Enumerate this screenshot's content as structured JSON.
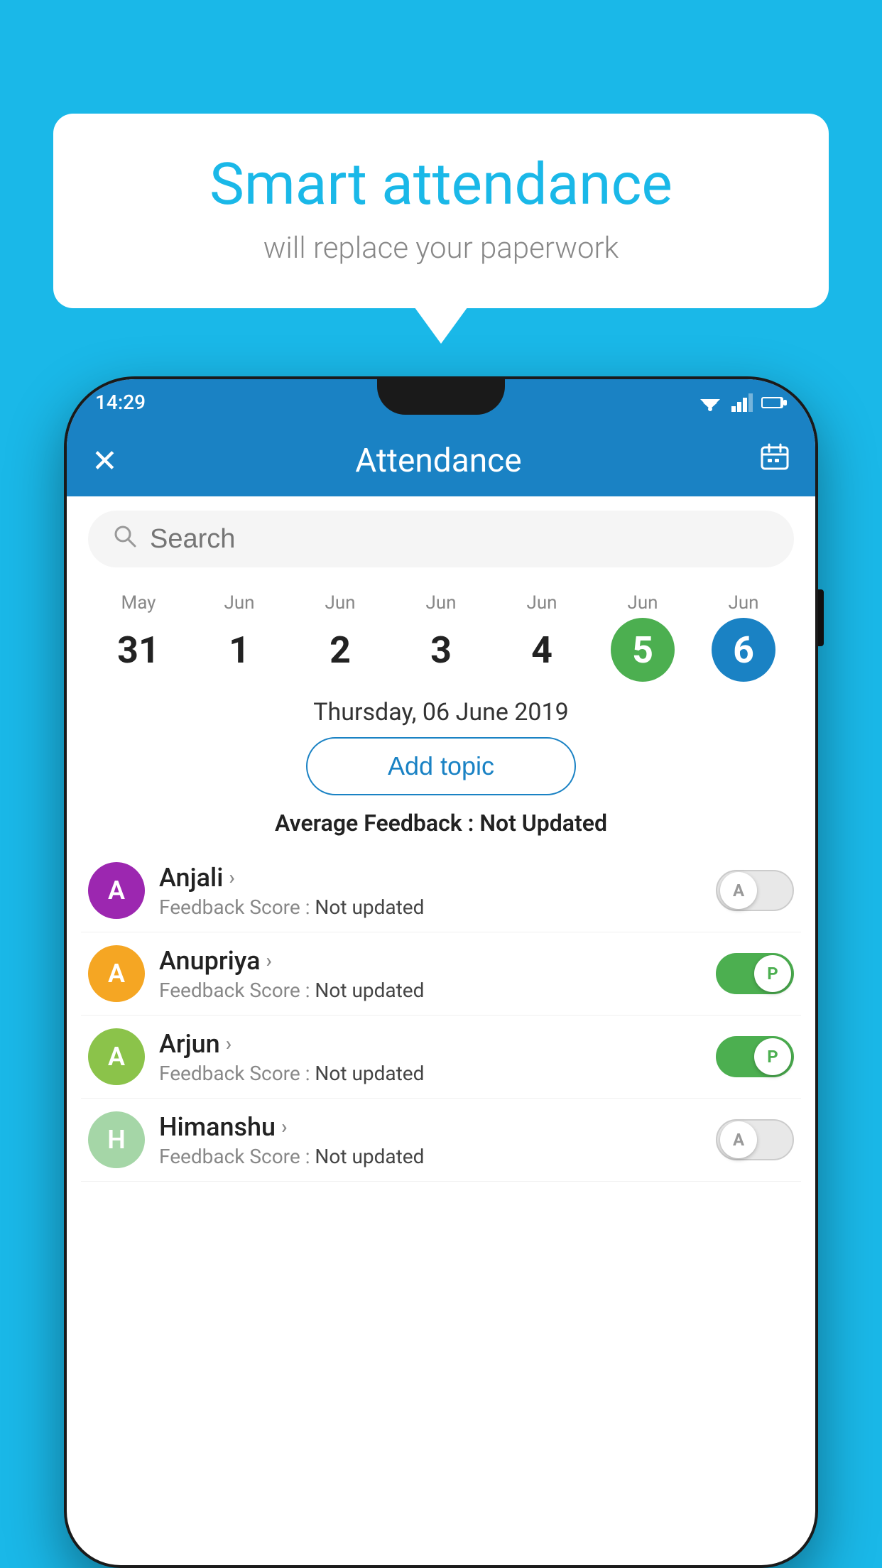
{
  "background_color": "#1ab8e8",
  "bubble": {
    "title": "Smart attendance",
    "subtitle": "will replace your paperwork"
  },
  "status_bar": {
    "time": "14:29"
  },
  "app_bar": {
    "title": "Attendance",
    "close_icon": "✕",
    "calendar_icon": "📅"
  },
  "search": {
    "placeholder": "Search"
  },
  "calendar": {
    "days": [
      {
        "month": "May",
        "date": "31",
        "state": "normal"
      },
      {
        "month": "Jun",
        "date": "1",
        "state": "normal"
      },
      {
        "month": "Jun",
        "date": "2",
        "state": "normal"
      },
      {
        "month": "Jun",
        "date": "3",
        "state": "normal"
      },
      {
        "month": "Jun",
        "date": "4",
        "state": "normal"
      },
      {
        "month": "Jun",
        "date": "5",
        "state": "today"
      },
      {
        "month": "Jun",
        "date": "6",
        "state": "selected"
      }
    ]
  },
  "selected_date_label": "Thursday, 06 June 2019",
  "add_topic_label": "Add topic",
  "avg_feedback_prefix": "Average Feedback : ",
  "avg_feedback_value": "Not Updated",
  "students": [
    {
      "name": "Anjali",
      "avatar_letter": "A",
      "avatar_color": "#9c27b0",
      "feedback_prefix": "Feedback Score : ",
      "feedback_value": "Not updated",
      "toggle": "off",
      "toggle_label": "A"
    },
    {
      "name": "Anupriya",
      "avatar_letter": "A",
      "avatar_color": "#f5a623",
      "feedback_prefix": "Feedback Score : ",
      "feedback_value": "Not updated",
      "toggle": "on",
      "toggle_label": "P"
    },
    {
      "name": "Arjun",
      "avatar_letter": "A",
      "avatar_color": "#8bc34a",
      "feedback_prefix": "Feedback Score : ",
      "feedback_value": "Not updated",
      "toggle": "on",
      "toggle_label": "P"
    },
    {
      "name": "Himanshu",
      "avatar_letter": "H",
      "avatar_color": "#a5d6a7",
      "feedback_prefix": "Feedback Score : ",
      "feedback_value": "Not updated",
      "toggle": "off",
      "toggle_label": "A"
    }
  ]
}
